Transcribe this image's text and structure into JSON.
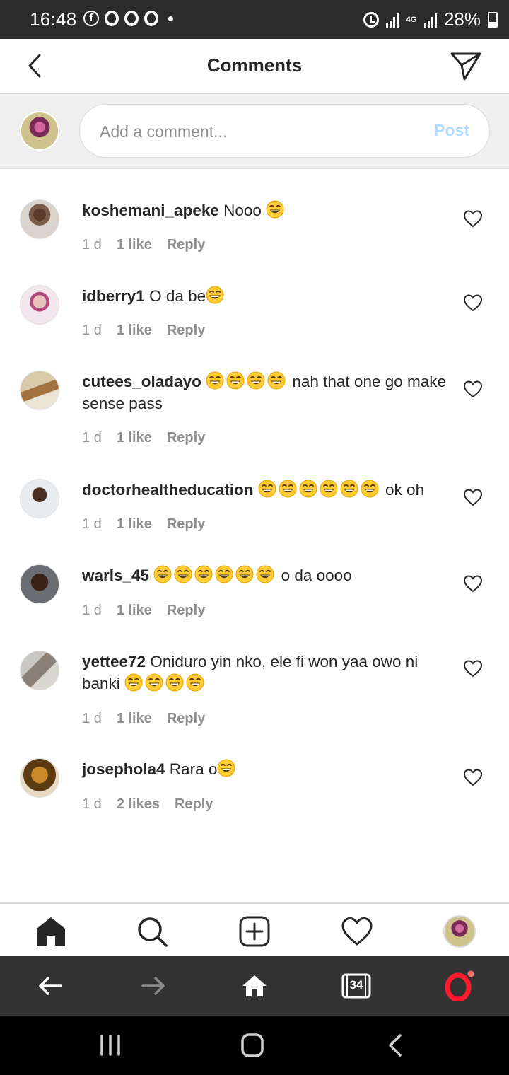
{
  "status_bar": {
    "time": "16:48",
    "battery": "28%",
    "network": "4G"
  },
  "header": {
    "title": "Comments"
  },
  "composer": {
    "placeholder": "Add a comment...",
    "post_label": "Post"
  },
  "comments": [
    {
      "username": "koshemani_apeke",
      "text": "Nooo",
      "emoji_count": 1,
      "time": "1 d",
      "likes": "1 like",
      "reply": "Reply"
    },
    {
      "username": "idberry1",
      "text": "O da be",
      "emoji_count": 1,
      "time": "1 d",
      "likes": "1 like",
      "reply": "Reply"
    },
    {
      "username": "cutees_oladayo",
      "text": "nah that one go make sense pass",
      "emoji_count": 4,
      "time": "1 d",
      "likes": "1 like",
      "reply": "Reply"
    },
    {
      "username": "doctorhealtheducation",
      "text": "ok oh",
      "emoji_count": 6,
      "time": "1 d",
      "likes": "1 like",
      "reply": "Reply"
    },
    {
      "username": "warls_45",
      "text": "o da oooo",
      "emoji_count": 6,
      "time": "1 d",
      "likes": "1 like",
      "reply": "Reply"
    },
    {
      "username": "yettee72",
      "text": "Oniduro yin nko, ele fi won yaa owo ni banki",
      "emoji_count": 4,
      "time": "1 d",
      "likes": "1 like",
      "reply": "Reply"
    },
    {
      "username": "josephola4",
      "text": "Rara o",
      "emoji_count": 1,
      "time": "1 d",
      "likes": "2 likes",
      "reply": "Reply"
    }
  ],
  "browser_bar": {
    "tab_count": "34"
  },
  "colors": {
    "accent_disabled": "#b3dbff",
    "secondary_text": "#8e8e8e",
    "opera_red": "#ff1b2d"
  }
}
